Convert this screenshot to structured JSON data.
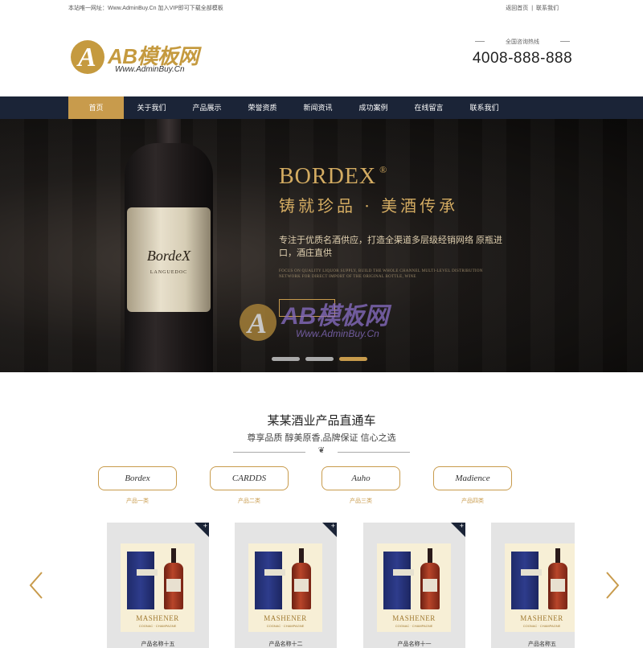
{
  "topbar": {
    "notice": "本站唯一网址：Www.AdminBuy.Cn 加入VIP即可下载全部模板",
    "links": [
      "返回首页",
      "|",
      "联系我们"
    ]
  },
  "header": {
    "logo_brand": "AB模板网",
    "logo_url": "Www.AdminBuy.Cn",
    "hotline_label": "全国咨询热线",
    "hotline_number": "4008-888-888"
  },
  "nav": {
    "items": [
      "首页",
      "关于我们",
      "产品展示",
      "荣誉资质",
      "新闻资讯",
      "成功案例",
      "在线留言",
      "联系我们"
    ],
    "active_index": 0
  },
  "banner": {
    "bottle_label": "BordeX",
    "bottle_label_sub": "LANGUEDOC",
    "title": "BORDEX",
    "title_mark": "®",
    "slogan": "铸就珍品 · 美酒传承",
    "desc": "专注于优质名酒供应，打造全渠道多层级经销网络 原瓶进口，酒庄直供",
    "desc_en": "FOCUS ON QUALITY LIQUOR SUPPLY, BUILD THE WHOLE CHANNEL MULTI-LEVEL DISTRIBUTION NETWORK FOR DIRECT IMPORT OF THE ORIGINAL BOTTLE, WINE",
    "watermark_brand": "AB模板网",
    "watermark_url": "Www.AdminBuy.Cn",
    "slide_count": 3,
    "active_slide": 2
  },
  "products_section": {
    "title": "某某酒业产品直通车",
    "subtitle": "尊享品质 醇美原香,品牌保证 信心之选",
    "ornament": "❦",
    "categories": [
      {
        "pill": "Bordex",
        "name": "产品一类"
      },
      {
        "pill": "CARDDS",
        "name": "产品二类"
      },
      {
        "pill": "Auho",
        "name": "产品三类"
      },
      {
        "pill": "Madience",
        "name": "产品四类"
      }
    ],
    "products": [
      {
        "brand": "MASHENER",
        "brand_sub": "COGNAC · CHAMPAGNE",
        "name": "产品名称十五"
      },
      {
        "brand": "MASHENER",
        "brand_sub": "COGNAC · CHAMPAGNE",
        "name": "产品名称十二"
      },
      {
        "brand": "MASHENER",
        "brand_sub": "COGNAC · CHAMPAGNE",
        "name": "产品名称十一"
      },
      {
        "brand": "MASHENER",
        "brand_sub": "COGNAC · CHAMPAGNE",
        "name": "产品名称五"
      }
    ],
    "corner_symbol": "+"
  },
  "colors": {
    "accent_gold": "#c89b4c",
    "nav_bg": "#1b2437"
  },
  "icons": {
    "prev": "chevron-left-icon",
    "next": "chevron-right-icon"
  }
}
